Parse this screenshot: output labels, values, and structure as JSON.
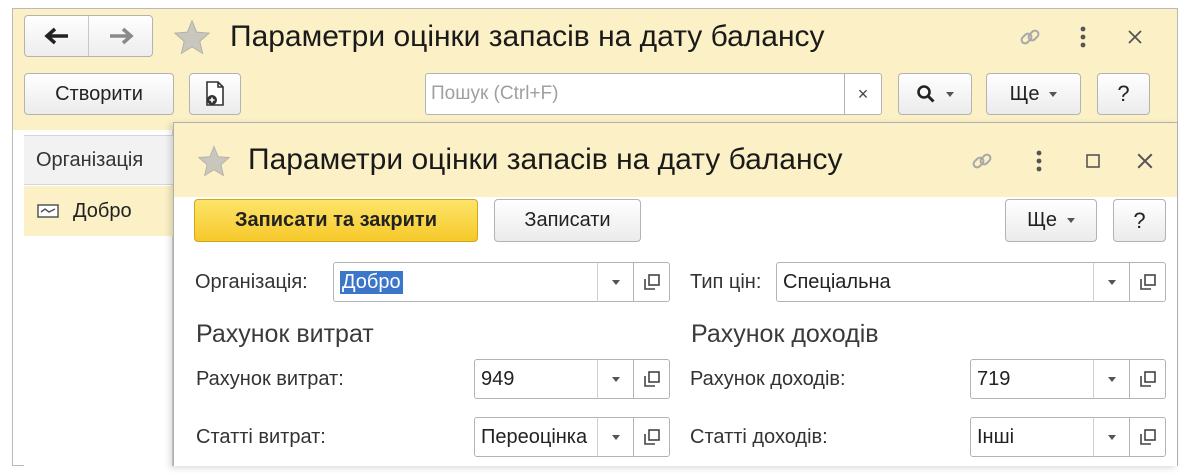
{
  "outer_window": {
    "title": "Параметри оцінки запасів на дату балансу",
    "toolbar": {
      "create_label": "Створити",
      "search_placeholder": "Пошук (Ctrl+F)",
      "search_clear": "×",
      "more_label": "Ще",
      "help_label": "?"
    },
    "list": {
      "header": "Організація",
      "rows": [
        {
          "text": "Добро"
        }
      ]
    }
  },
  "form_window": {
    "title": "Параметри оцінки запасів на дату балансу",
    "buttons": {
      "save_close": "Записати та закрити",
      "save": "Записати",
      "more": "Ще",
      "help": "?"
    },
    "organization": {
      "label": "Організація:",
      "value": "Добро"
    },
    "price_type": {
      "label": "Тип цін:",
      "value": "Спеціальна"
    },
    "expense_section": {
      "title": "Рахунок витрат",
      "account_label": "Рахунок витрат:",
      "account_value": "949",
      "items_label": "Статті витрат:",
      "items_value": "Переоцінка"
    },
    "income_section": {
      "title": "Рахунок доходів",
      "account_label": "Рахунок доходів:",
      "account_value": "719",
      "items_label": "Статті доходів:",
      "items_value": "Інші"
    }
  },
  "colors": {
    "title_bar_bg": "#fbf0c6",
    "primary_button": "#f6c92a",
    "selection": "#3b76c9"
  },
  "icons": [
    "back-arrow-icon",
    "forward-arrow-icon",
    "favorite-star-icon",
    "link-icon",
    "more-vertical-icon",
    "close-icon",
    "new-document-icon",
    "search-icon",
    "maximize-icon",
    "open-form-icon",
    "row-item-icon"
  ]
}
